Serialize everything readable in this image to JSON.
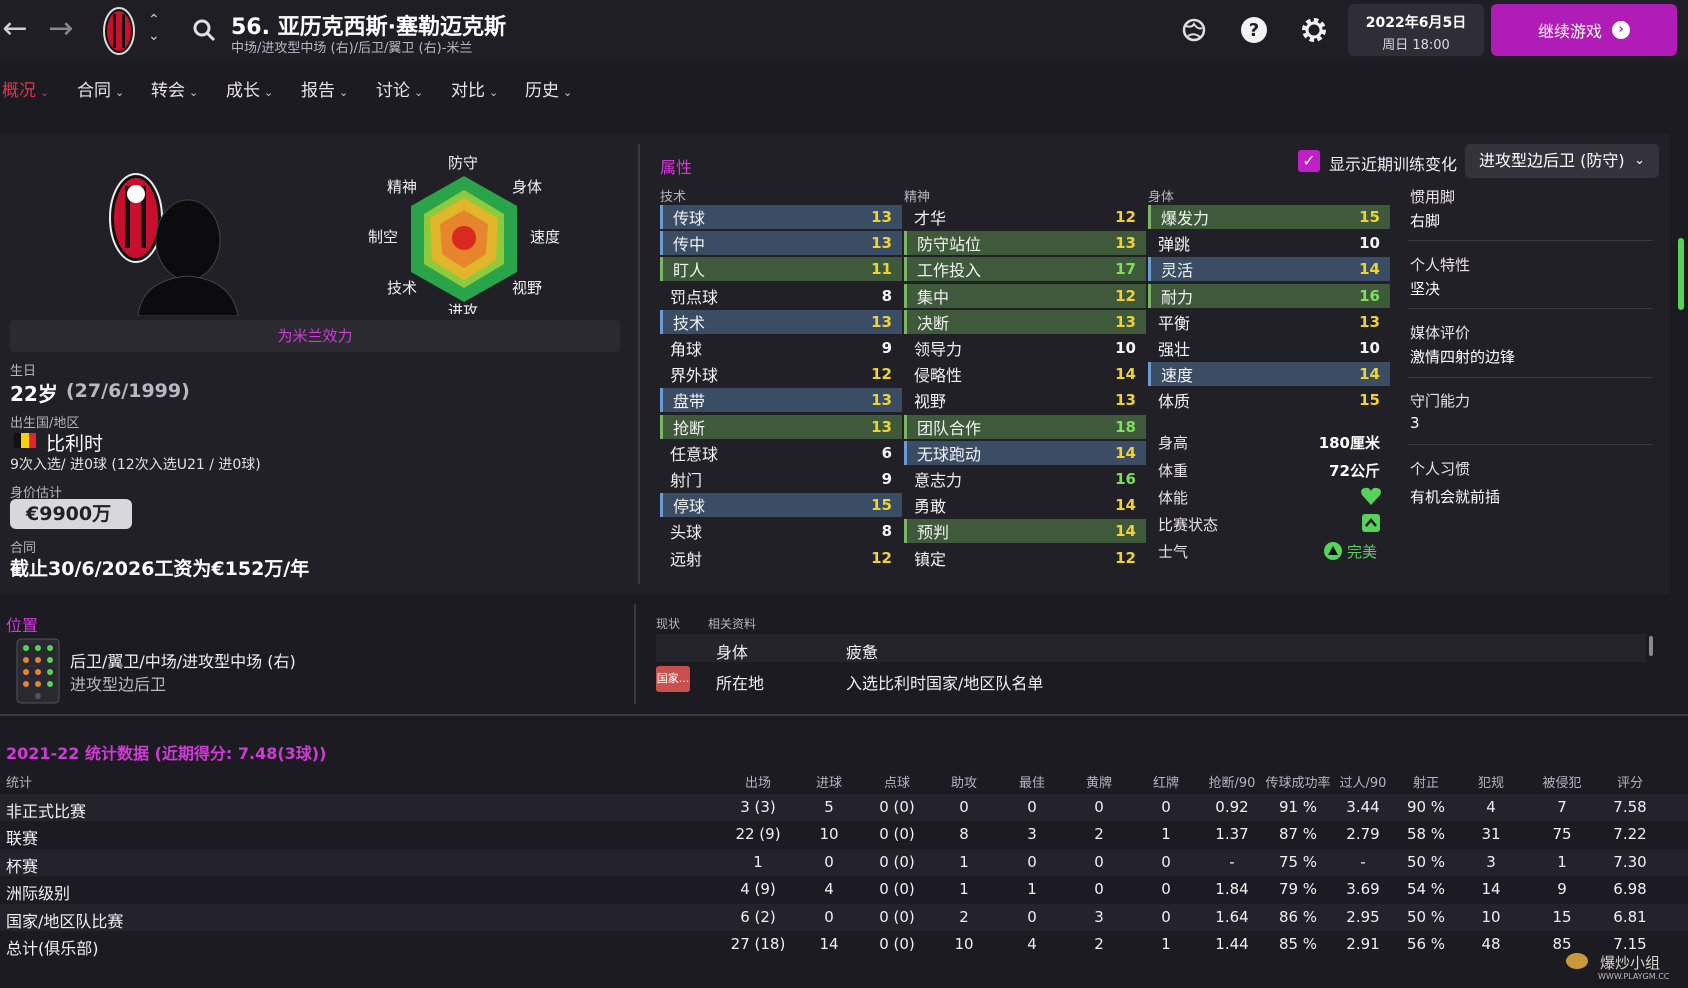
{
  "header": {
    "title": "56. 亚历克西斯·塞勒迈克斯",
    "subtitle": "中场/进攻型中场 (右)/后卫/翼卫 (右)-米兰",
    "date": "2022年6月5日",
    "day_time": "周日 18:00",
    "continue_label": "继续游戏"
  },
  "tabs": [
    {
      "label": "概况",
      "active": true
    },
    {
      "label": "合同"
    },
    {
      "label": "转会"
    },
    {
      "label": "成长"
    },
    {
      "label": "报告"
    },
    {
      "label": "讨论"
    },
    {
      "label": "对比"
    },
    {
      "label": "历史"
    }
  ],
  "radar": {
    "labels": [
      "防守",
      "身体",
      "速度",
      "视野",
      "进攻",
      "技术",
      "制空",
      "精神"
    ]
  },
  "profile": {
    "club_banner": "为米兰效力",
    "birth_label": "生日",
    "age": "22岁",
    "dob": "(27/6/1999)",
    "nation_label": "出生国/地区",
    "nation": "比利时",
    "caps": "9次入选/ 进0球 (12次入选U21 / 进0球)",
    "value_label": "身价估计",
    "value": "€9900万",
    "contract_label": "合同",
    "contract": "截止30/6/2026工资为€152万/年"
  },
  "attributes": {
    "section_title": "属性",
    "show_training_label": "显示近期训练变化",
    "role_select": "进攻型边后卫 (防守)",
    "technical_head": "技术",
    "mental_head": "精神",
    "physical_head": "身体",
    "technical": [
      {
        "name": "传球",
        "value": "13",
        "hl": "b"
      },
      {
        "name": "传中",
        "value": "13",
        "hl": "b"
      },
      {
        "name": "盯人",
        "value": "11",
        "hl": "g"
      },
      {
        "name": "罚点球",
        "value": "8",
        "hl": ""
      },
      {
        "name": "技术",
        "value": "13",
        "hl": "b"
      },
      {
        "name": "角球",
        "value": "9",
        "hl": ""
      },
      {
        "name": "界外球",
        "value": "12",
        "hl": ""
      },
      {
        "name": "盘带",
        "value": "13",
        "hl": "b"
      },
      {
        "name": "抢断",
        "value": "13",
        "hl": "g"
      },
      {
        "name": "任意球",
        "value": "6",
        "hl": ""
      },
      {
        "name": "射门",
        "value": "9",
        "hl": ""
      },
      {
        "name": "停球",
        "value": "15",
        "hl": "b"
      },
      {
        "name": "头球",
        "value": "8",
        "hl": ""
      },
      {
        "name": "远射",
        "value": "12",
        "hl": ""
      }
    ],
    "mental": [
      {
        "name": "才华",
        "value": "12",
        "hl": ""
      },
      {
        "name": "防守站位",
        "value": "13",
        "hl": "g"
      },
      {
        "name": "工作投入",
        "value": "17",
        "hl": "g"
      },
      {
        "name": "集中",
        "value": "12",
        "hl": "g"
      },
      {
        "name": "决断",
        "value": "13",
        "hl": "g"
      },
      {
        "name": "领导力",
        "value": "10",
        "hl": ""
      },
      {
        "name": "侵略性",
        "value": "14",
        "hl": ""
      },
      {
        "name": "视野",
        "value": "13",
        "hl": ""
      },
      {
        "name": "团队合作",
        "value": "18",
        "hl": "g"
      },
      {
        "name": "无球跑动",
        "value": "14",
        "hl": "b"
      },
      {
        "name": "意志力",
        "value": "16",
        "hl": ""
      },
      {
        "name": "勇敢",
        "value": "14",
        "hl": ""
      },
      {
        "name": "预判",
        "value": "14",
        "hl": "g"
      },
      {
        "name": "镇定",
        "value": "12",
        "hl": ""
      }
    ],
    "physical": [
      {
        "name": "爆发力",
        "value": "15",
        "hl": "g"
      },
      {
        "name": "弹跳",
        "value": "10",
        "hl": ""
      },
      {
        "name": "灵活",
        "value": "14",
        "hl": "b"
      },
      {
        "name": "耐力",
        "value": "16",
        "hl": "g"
      },
      {
        "name": "平衡",
        "value": "13",
        "hl": ""
      },
      {
        "name": "强壮",
        "value": "10",
        "hl": ""
      },
      {
        "name": "速度",
        "value": "14",
        "hl": "b"
      },
      {
        "name": "体质",
        "value": "15",
        "hl": ""
      }
    ],
    "height_label": "身高",
    "height": "180厘米",
    "weight_label": "体重",
    "weight": "72公斤",
    "condition_label": "体能",
    "match_form_label": "比赛状态",
    "morale_label": "士气",
    "morale": "完美"
  },
  "side_info": {
    "foot_label": "惯用脚",
    "foot": "右脚",
    "trait_label": "个人特性",
    "trait": "坚决",
    "media_label": "媒体评价",
    "media": "激情四射的边锋",
    "gk_label": "守门能力",
    "gk": "3",
    "habit_label": "个人习惯",
    "habit": "有机会就前插"
  },
  "position": {
    "title": "位置",
    "positions": "后卫/翼卫/中场/进攻型中场 (右)",
    "role": "进攻型边后卫"
  },
  "status": {
    "tab_current": "现状",
    "tab_related": "相关资料",
    "row1_a": "身体",
    "row1_b": "疲惫",
    "row2_badge": "国家...",
    "row2_a": "所在地",
    "row2_b": "入选比利时国家/地区队名单"
  },
  "stats": {
    "title": "2021-22 统计数据 (近期得分: 7.48(3球))",
    "label_col": "统计",
    "columns": [
      "出场",
      "进球",
      "点球",
      "助攻",
      "最佳",
      "黄牌",
      "红牌",
      "抢断/90",
      "传球成功率",
      "过人/90",
      "射正",
      "犯规",
      "被侵犯",
      "评分"
    ],
    "rows": [
      {
        "name": "非正式比赛",
        "cells": [
          "3 (3)",
          "5",
          "0 (0)",
          "0",
          "0",
          "0",
          "0",
          "0.92",
          "91 %",
          "3.44",
          "90 %",
          "4",
          "7",
          "7.58"
        ]
      },
      {
        "name": "联赛",
        "cells": [
          "22 (9)",
          "10",
          "0 (0)",
          "8",
          "3",
          "2",
          "1",
          "1.37",
          "87 %",
          "2.79",
          "58 %",
          "31",
          "75",
          "7.22"
        ]
      },
      {
        "name": "杯赛",
        "cells": [
          "1",
          "0",
          "0 (0)",
          "1",
          "0",
          "0",
          "0",
          "-",
          "75 %",
          "-",
          "50 %",
          "3",
          "1",
          "7.30"
        ]
      },
      {
        "name": "洲际级别",
        "cells": [
          "4 (9)",
          "4",
          "0 (0)",
          "1",
          "1",
          "0",
          "0",
          "1.84",
          "79 %",
          "3.69",
          "54 %",
          "14",
          "9",
          "6.98"
        ]
      },
      {
        "name": "国家/地区队比赛",
        "cells": [
          "6 (2)",
          "0",
          "0 (0)",
          "2",
          "0",
          "3",
          "0",
          "1.64",
          "86 %",
          "2.95",
          "50 %",
          "10",
          "15",
          "6.81"
        ]
      },
      {
        "name": "总计(俱乐部)",
        "cells": [
          "27 (18)",
          "14",
          "0 (0)",
          "10",
          "4",
          "2",
          "1",
          "1.44",
          "85 %",
          "2.91",
          "56 %",
          "48",
          "85",
          "7.15"
        ]
      }
    ]
  }
}
